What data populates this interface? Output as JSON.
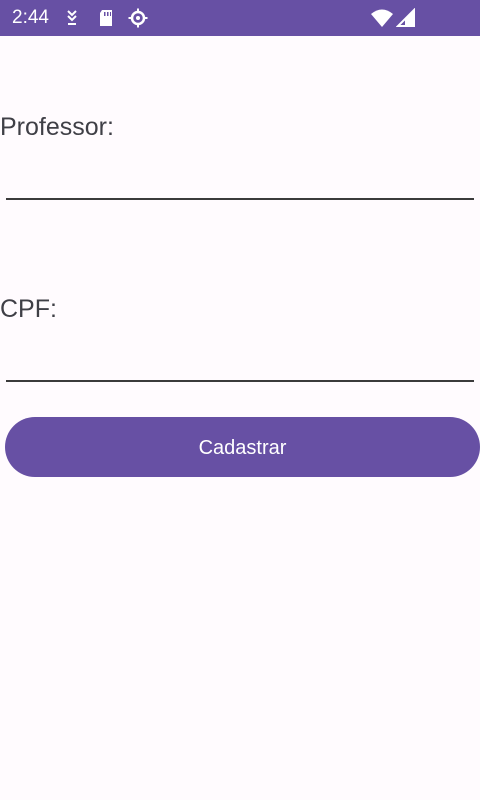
{
  "status_bar": {
    "time": "2:44",
    "icons": [
      "download-icon",
      "sd-card-icon",
      "settings-gear-icon",
      "wifi-icon",
      "cellular-signal-icon"
    ],
    "background": "#6750a4"
  },
  "form": {
    "professor_label": "Professor:",
    "professor_value": "",
    "cpf_label": "CPF:",
    "cpf_value": "",
    "submit_label": "Cadastrar"
  },
  "colors": {
    "accent": "#6750a4",
    "background": "#fffbfe",
    "text": "#3f3f46"
  }
}
